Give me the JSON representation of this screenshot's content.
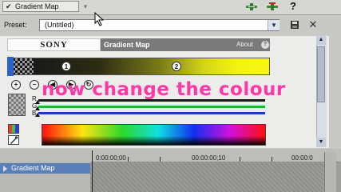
{
  "chain": {
    "effect_label": "Gradient Map",
    "checked_glyph": "✔",
    "dropdown_glyph": "▾",
    "icons": [
      "add-plugin-icon",
      "remove-plugin-icon",
      "help-icon"
    ],
    "help_glyph": "?"
  },
  "preset": {
    "label": "Preset:",
    "value": "(Untitled)",
    "dropdown_glyph": "▼",
    "save_glyph": "▪",
    "delete_glyph": "✕"
  },
  "plugin": {
    "brand": "SONY",
    "title": "Gradient Map",
    "about": "About",
    "about_glyph": "?",
    "markers": [
      "1",
      "2"
    ],
    "buttons": [
      "+",
      "−",
      "◀",
      "▶",
      "↻"
    ],
    "channels": [
      "R",
      "G",
      "B"
    ],
    "colors": {
      "gradient_start": "#101010",
      "gradient_end": "#f6f610",
      "red_channel": "#1a1a1a",
      "green_channel": "#22b52a",
      "blue_channel": "#1c39c6",
      "accent": "#2a63c8"
    }
  },
  "overlay": {
    "caption": "now change the colour",
    "color": "#ff38a8"
  },
  "scrollbar": {
    "up_glyph": "▲",
    "down_glyph": "▼"
  },
  "timeline": {
    "track_name": "Gradient Map",
    "timecodes": [
      "0:00:00;00",
      "00:00:00;10",
      "00:00:0"
    ]
  }
}
